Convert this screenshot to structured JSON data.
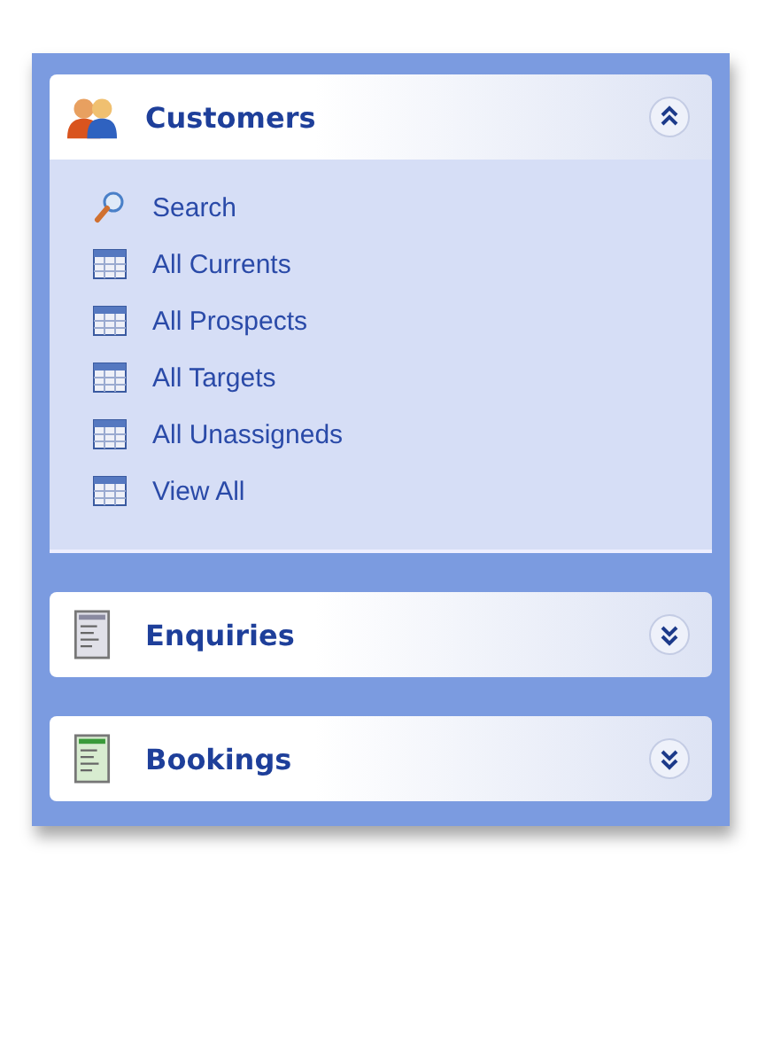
{
  "groups": [
    {
      "title": "Customers",
      "kind": "people",
      "expanded": true,
      "items": [
        {
          "label": "Search",
          "kind": "search"
        },
        {
          "label": "All Currents",
          "kind": "grid"
        },
        {
          "label": "All Prospects",
          "kind": "grid"
        },
        {
          "label": "All Targets",
          "kind": "grid"
        },
        {
          "label": "All Unassigneds",
          "kind": "grid"
        },
        {
          "label": "View All",
          "kind": "grid"
        }
      ]
    },
    {
      "title": "Enquiries",
      "kind": "grey-doc",
      "expanded": false
    },
    {
      "title": "Bookings",
      "kind": "green-doc",
      "expanded": false
    }
  ]
}
